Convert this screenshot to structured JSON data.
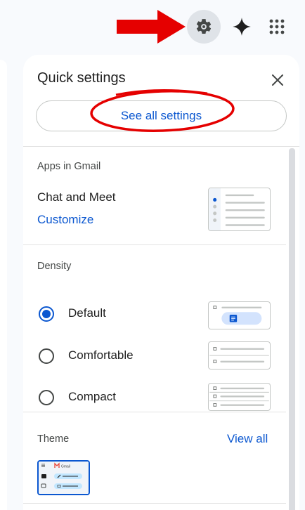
{
  "topbar": {
    "icons": [
      "settings-gear-icon",
      "gemini-sparkle-icon",
      "google-apps-grid-icon"
    ],
    "annotation_color": "#e50000"
  },
  "quick_settings": {
    "title": "Quick settings",
    "see_all_label": "See all settings",
    "close_icon": "close-icon"
  },
  "apps_in_gmail": {
    "heading": "Apps in Gmail",
    "option": "Chat and Meet",
    "customize_label": "Customize"
  },
  "density": {
    "heading": "Density",
    "options": [
      {
        "label": "Default",
        "selected": true
      },
      {
        "label": "Comfortable",
        "selected": false
      },
      {
        "label": "Compact",
        "selected": false
      }
    ]
  },
  "theme": {
    "heading": "Theme",
    "view_all_label": "View all",
    "preview_logo_text": "Gmail"
  },
  "colors": {
    "accent": "#0b57d0",
    "annotation_red": "#e50000",
    "gear_button_bg": "#dfe3e8"
  }
}
